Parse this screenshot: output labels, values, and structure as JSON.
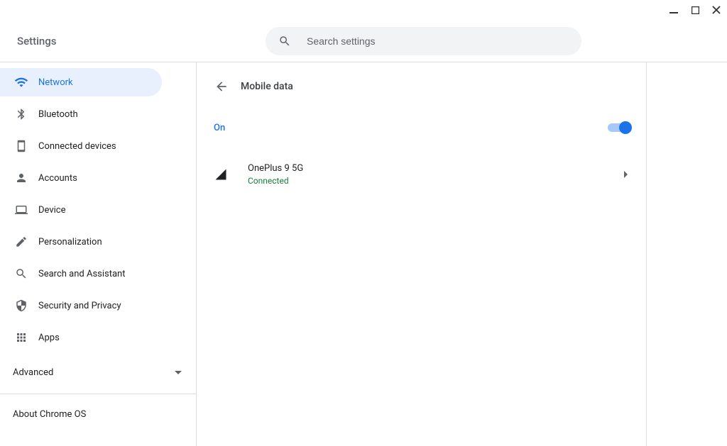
{
  "header": {
    "title": "Settings",
    "search_placeholder": "Search settings"
  },
  "sidebar": {
    "items": [
      {
        "label": "Network"
      },
      {
        "label": "Bluetooth"
      },
      {
        "label": "Connected devices"
      },
      {
        "label": "Accounts"
      },
      {
        "label": "Device"
      },
      {
        "label": "Personalization"
      },
      {
        "label": "Search and Assistant"
      },
      {
        "label": "Security and Privacy"
      },
      {
        "label": "Apps"
      }
    ],
    "advanced_label": "Advanced",
    "about_label": "About Chrome OS"
  },
  "content": {
    "page_title": "Mobile data",
    "toggle_state_label": "On",
    "device_name": "OnePlus 9 5G",
    "device_status": "Connected"
  }
}
